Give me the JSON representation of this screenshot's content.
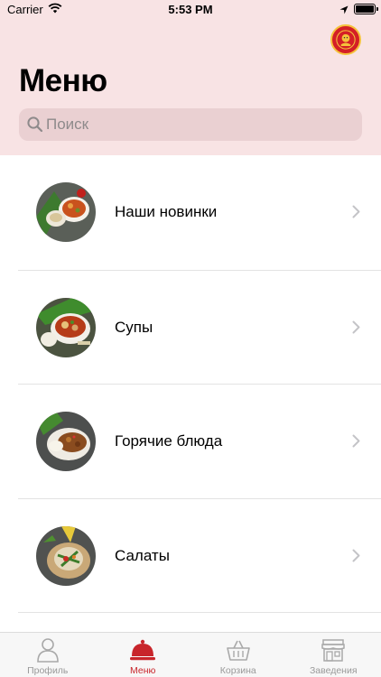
{
  "status_bar": {
    "carrier": "Carrier",
    "time": "5:53 PM"
  },
  "header": {
    "title": "Меню",
    "logo_icon": "restaurant-logo"
  },
  "search": {
    "placeholder": "Поиск",
    "icon": "search-icon"
  },
  "menu_categories": [
    {
      "label": "Наши новинки",
      "icon": "dish-photo-new"
    },
    {
      "label": "Супы",
      "icon": "dish-photo-soup"
    },
    {
      "label": "Горячие блюда",
      "icon": "dish-photo-hot"
    },
    {
      "label": "Салаты",
      "icon": "dish-photo-salad"
    }
  ],
  "tabbar": {
    "items": [
      {
        "label": "Профиль",
        "icon": "person-icon",
        "active": false
      },
      {
        "label": "Меню",
        "icon": "cloche-icon",
        "active": true
      },
      {
        "label": "Корзина",
        "icon": "basket-icon",
        "active": false
      },
      {
        "label": "Заведения",
        "icon": "store-icon",
        "active": false
      }
    ]
  },
  "colors": {
    "header_bg": "#f8e3e4",
    "search_bg": "#ead0d2",
    "accent": "#c8252b",
    "tab_inactive": "#999999"
  }
}
